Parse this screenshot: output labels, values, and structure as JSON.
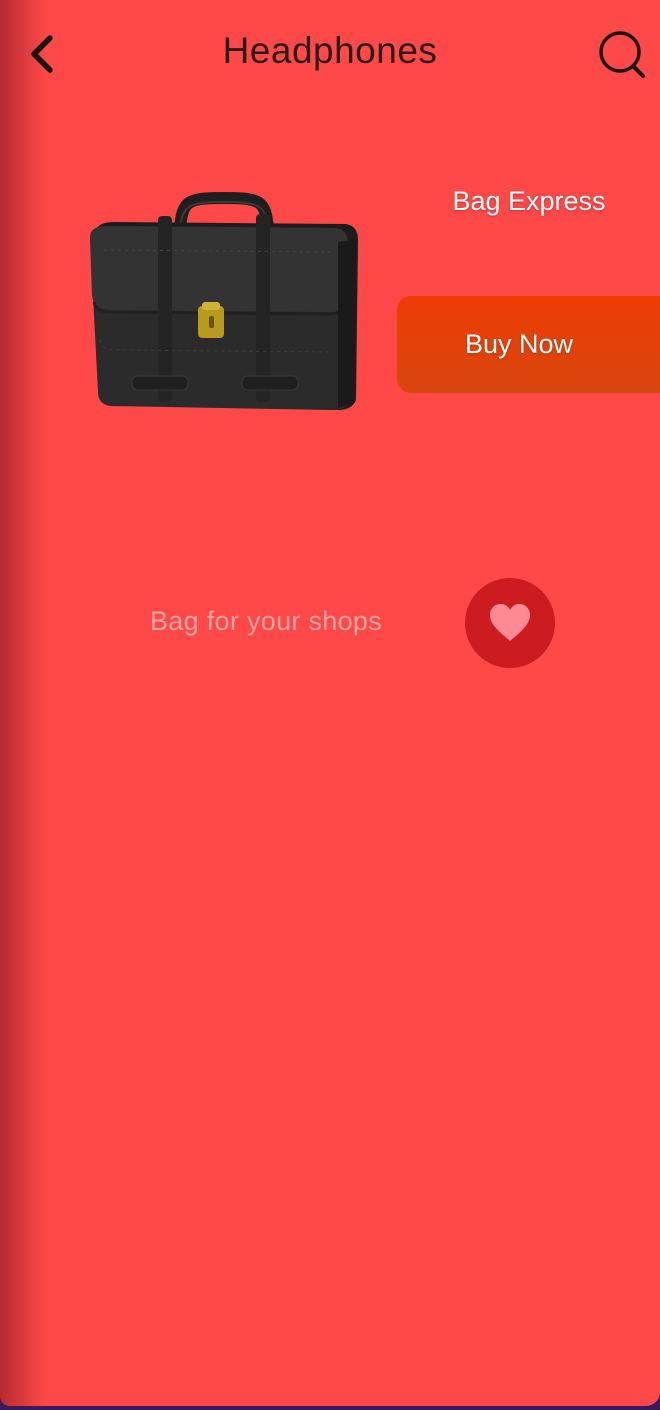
{
  "header": {
    "title": "Headphones",
    "back_icon": "chevron-left-icon",
    "search_icon": "search-icon"
  },
  "product": {
    "brand": "Bag Express",
    "buy_label": "Buy Now",
    "description": "Bag for your shops",
    "favorite_icon": "heart-icon"
  },
  "colors": {
    "background": "#ff4848",
    "buy_button": "#ee3c05",
    "favorite_button": "#cc1c20",
    "heart": "#ff8a93"
  }
}
